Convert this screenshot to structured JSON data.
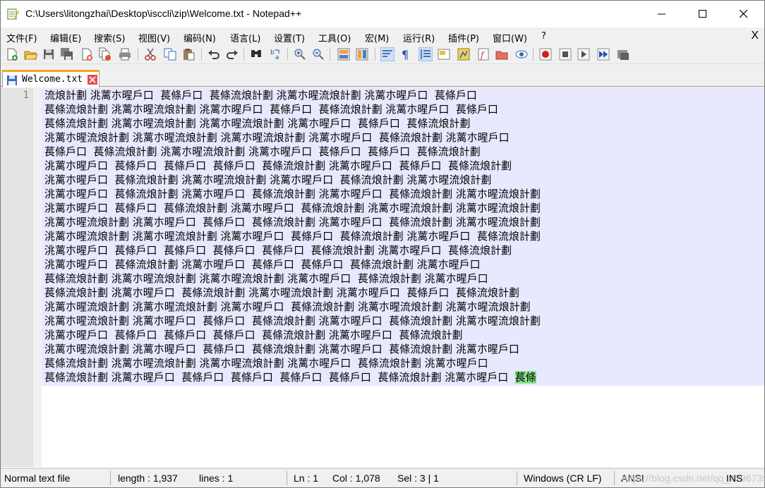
{
  "window": {
    "title": "C:\\Users\\litongzhai\\Desktop\\isccli\\zip\\Welcome.txt - Notepad++"
  },
  "menu": {
    "items": [
      "文件(F)",
      "编辑(E)",
      "搜索(S)",
      "视图(V)",
      "编码(N)",
      "语言(L)",
      "设置(T)",
      "工具(O)",
      "宏(M)",
      "运行(R)",
      "插件(P)",
      "窗口(W)",
      "?"
    ],
    "close": "X"
  },
  "tab": {
    "label": "Welcome.txt"
  },
  "editor": {
    "line_number": "1",
    "lines": [
      "流烺計劃 洮蓠朩暒戶口  萇條戶口  萇條流烺計劃 洮蓠朩暒流烺計劃 洮蓠朩暒戶口  萇條戶口",
      "萇條流烺計劃 洮蓠朩暒流烺計劃 洮蓠朩暒戶口  萇條戶口  萇條流烺計劃 洮蓠朩暒戶口  萇條戶口",
      "萇條流烺計劃 洮蓠朩暒流烺計劃 洮蓠朩暒流烺計劃 洮蓠朩暒戶口  萇條戶口  萇條流烺計劃",
      "洮蓠朩暒流烺計劃 洮蓠朩暒流烺計劃 洮蓠朩暒流烺計劃 洮蓠朩暒戶口  萇條流烺計劃 洮蓠朩暒戶口",
      "萇條戶口  萇條流烺計劃 洮蓠朩暒流烺計劃 洮蓠朩暒戶口  萇條戶口  萇條戶口  萇條流烺計劃",
      "洮蓠朩暒戶口  萇條戶口  萇條戶口  萇條戶口  萇條流烺計劃 洮蓠朩暒戶口  萇條戶口  萇條流烺計劃",
      "洮蓠朩暒戶口  萇條流烺計劃 洮蓠朩暒流烺計劃 洮蓠朩暒戶口  萇條流烺計劃 洮蓠朩暒流烺計劃",
      "洮蓠朩暒戶口  萇條流烺計劃 洮蓠朩暒戶口  萇條流烺計劃 洮蓠朩暒戶口  萇條流烺計劃 洮蓠朩暒流烺計劃",
      "洮蓠朩暒戶口  萇條戶口  萇條流烺計劃 洮蓠朩暒戶口  萇條流烺計劃 洮蓠朩暒流烺計劃 洮蓠朩暒流烺計劃",
      "洮蓠朩暒流烺計劃 洮蓠朩暒戶口  萇條戶口  萇條流烺計劃 洮蓠朩暒戶口  萇條流烺計劃 洮蓠朩暒流烺計劃",
      "洮蓠朩暒流烺計劃 洮蓠朩暒流烺計劃 洮蓠朩暒戶口  萇條戶口  萇條流烺計劃 洮蓠朩暒戶口  萇條流烺計劃",
      "洮蓠朩暒戶口  萇條戶口  萇條戶口  萇條戶口  萇條戶口  萇條流烺計劃 洮蓠朩暒戶口  萇條流烺計劃",
      "洮蓠朩暒戶口  萇條流烺計劃 洮蓠朩暒戶口  萇條戶口  萇條戶口  萇條流烺計劃 洮蓠朩暒戶口",
      "萇條流烺計劃 洮蓠朩暒流烺計劃 洮蓠朩暒流烺計劃 洮蓠朩暒戶口  萇條流烺計劃 洮蓠朩暒戶口",
      "萇條流烺計劃 洮蓠朩暒戶口  萇條流烺計劃 洮蓠朩暒流烺計劃 洮蓠朩暒戶口  萇條戶口  萇條流烺計劃",
      "洮蓠朩暒流烺計劃 洮蓠朩暒流烺計劃 洮蓠朩暒戶口  萇條流烺計劃 洮蓠朩暒流烺計劃 洮蓠朩暒流烺計劃",
      "洮蓠朩暒流烺計劃 洮蓠朩暒戶口  萇條戶口  萇條流烺計劃 洮蓠朩暒戶口  萇條流烺計劃 洮蓠朩暒流烺計劃",
      "洮蓠朩暒戶口  萇條戶口  萇條戶口  萇條戶口  萇條流烺計劃 洮蓠朩暒戶口  萇條流烺計劃",
      "洮蓠朩暒流烺計劃 洮蓠朩暒戶口  萇條戶口  萇條流烺計劃 洮蓠朩暒戶口  萇條流烺計劃 洮蓠朩暒戶口",
      "萇條流烺計劃 洮蓠朩暒流烺計劃 洮蓠朩暒流烺計劃 洮蓠朩暒戶口  萇條流烺計劃 洮蓠朩暒戶口"
    ],
    "last_line_prefix": "萇條流烺計劃 洮蓠朩暒戶口  萇條戶口  萇條戶口  萇條戶口  萇條戶口  萇條流烺計劃 洮蓠朩暒戶口  ",
    "selected_text": "萇條",
    "text_bg_color": "#e8e8ff",
    "selection_color": "#8be48b"
  },
  "status": {
    "file_type": "Normal text file",
    "length": "length : 1,937",
    "lines": "lines : 1",
    "ln": "Ln : 1",
    "col": "Col : 1,078",
    "sel": "Sel : 3 | 1",
    "eol": "Windows (CR LF)",
    "encoding": "ANSI",
    "mode": "INS",
    "watermark": "https://blog.csdn.net/qq_42967398"
  }
}
